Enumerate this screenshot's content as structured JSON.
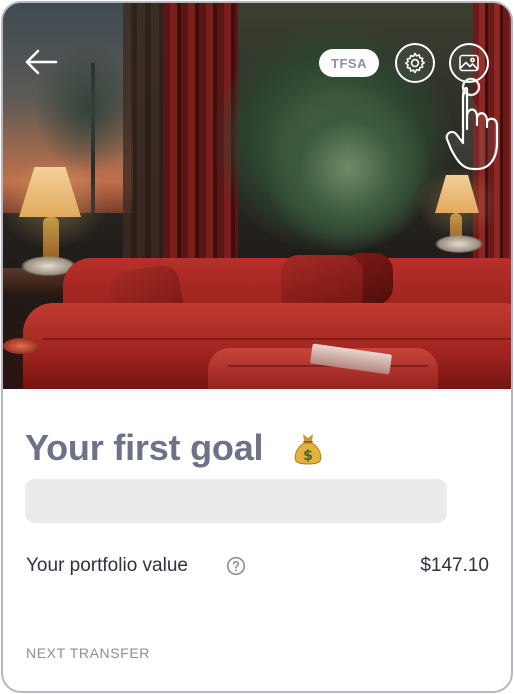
{
  "header": {
    "account_badge": "TFSA",
    "icons": {
      "back": "arrow-left-icon",
      "settings": "gear-icon",
      "change_image": "image-icon",
      "pointer": "hand-pointer-icon"
    },
    "photo_subject": "hero-background-photo"
  },
  "goal": {
    "title": "Your first goal",
    "emoji": "money-bag-icon",
    "progress_fraction": 0
  },
  "portfolio": {
    "label": "Your portfolio value",
    "help_icon": "question-circle-icon",
    "value": "$147.10"
  },
  "transfer": {
    "label": "NEXT TRANSFER"
  },
  "colors": {
    "title": "#6e7288",
    "text": "#2f3140",
    "muted": "#8a8ea2",
    "progress_track": "#ebebeb",
    "card_border": "#b8b6c2"
  }
}
